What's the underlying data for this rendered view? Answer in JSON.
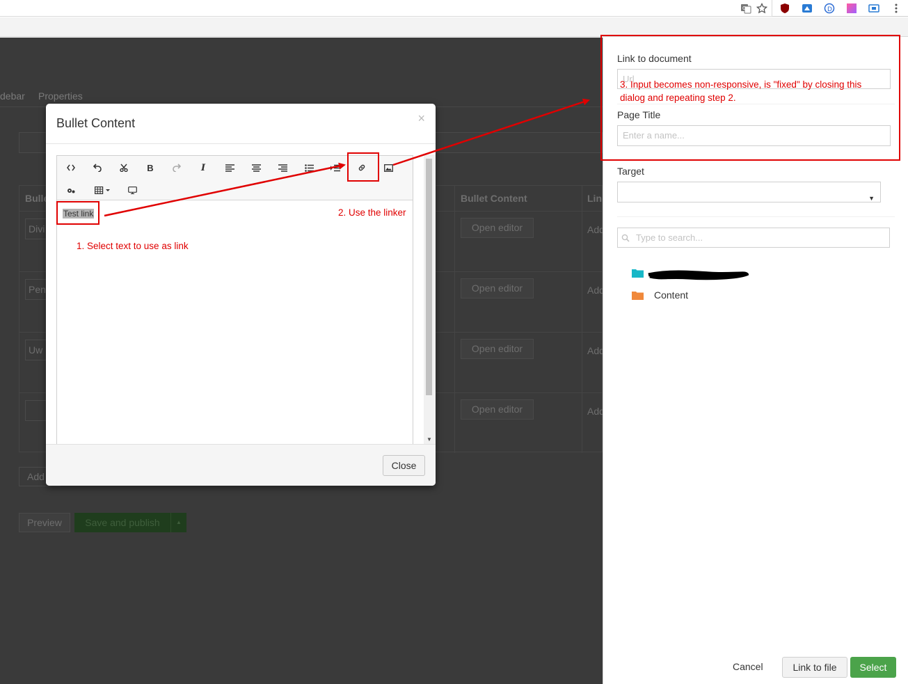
{
  "backoffice": {
    "tabs": [
      "debar",
      "Properties"
    ],
    "table": {
      "headers": [
        "Bulle",
        "Bullet Content",
        "Lin"
      ],
      "rows": [
        {
          "title": "Divi",
          "open_label": "Open editor",
          "add": "Add"
        },
        {
          "title": "Pen",
          "open_label": "Open editor",
          "add": "Add"
        },
        {
          "title": "Uw",
          "open_label": "Open editor",
          "add": "Add"
        },
        {
          "title": "",
          "open_label": "Open editor",
          "add": "Add"
        }
      ]
    },
    "add_button": "Add",
    "preview_button": "Preview",
    "save_button": "Save and publish"
  },
  "modal": {
    "title": "Bullet Content",
    "close_x": "×",
    "editor_text": "Test link",
    "close_button": "Close",
    "toolbar": [
      "source-code-icon",
      "undo-icon",
      "cut-icon",
      "bold-icon",
      "redo-icon",
      "italic-icon",
      "align-left-icon",
      "align-center-icon",
      "align-right-icon",
      "bullet-list-icon",
      "numbered-list-icon",
      "link-icon",
      "image-icon",
      "macro-icon",
      "table-icon",
      "embed-icon"
    ]
  },
  "panel": {
    "link_label": "Link to document",
    "url_placeholder": "Url",
    "page_title_label": "Page Title",
    "page_title_placeholder": "Enter a name...",
    "target_label": "Target",
    "target_value": "",
    "search_placeholder": "Type to search...",
    "tree": [
      {
        "label": "",
        "color": "#17b7c7"
      },
      {
        "label": "Content",
        "color": "#f0883a"
      }
    ],
    "cancel": "Cancel",
    "link_to_file": "Link to file",
    "select": "Select"
  },
  "annotations": {
    "step1": "1. Select text to use as link",
    "step2": "2. Use the linker",
    "step3_line1": "3. Input becomes non-responsive, is \"fixed\" by closing this",
    "step3_line2": "dialog and repeating step 2."
  },
  "colors": {
    "accent": "#4ba34a",
    "annotation": "#e00000"
  }
}
